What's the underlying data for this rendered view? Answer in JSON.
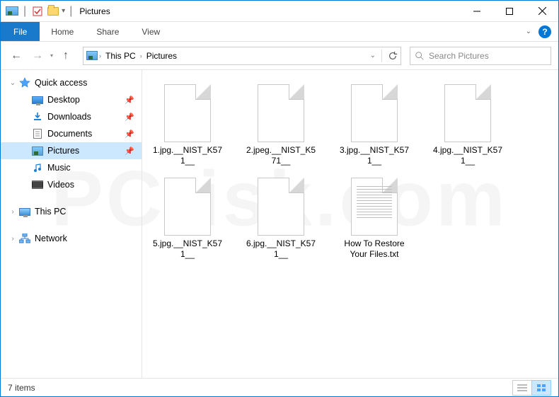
{
  "window": {
    "title": "Pictures"
  },
  "ribbon": {
    "file": "File",
    "tabs": [
      "Home",
      "Share",
      "View"
    ]
  },
  "breadcrumb": {
    "root": "This PC",
    "current": "Pictures"
  },
  "search": {
    "placeholder": "Search Pictures"
  },
  "sidebar": {
    "quick_access": "Quick access",
    "items": [
      {
        "label": "Desktop",
        "pin": true,
        "icon": "desktop"
      },
      {
        "label": "Downloads",
        "pin": true,
        "icon": "downloads"
      },
      {
        "label": "Documents",
        "pin": true,
        "icon": "documents"
      },
      {
        "label": "Pictures",
        "pin": true,
        "icon": "pictures",
        "selected": true
      },
      {
        "label": "Music",
        "pin": false,
        "icon": "music"
      },
      {
        "label": "Videos",
        "pin": false,
        "icon": "videos"
      }
    ],
    "this_pc": "This PC",
    "network": "Network"
  },
  "files": [
    {
      "name": "1.jpg.__NIST_K571__",
      "type": "blank"
    },
    {
      "name": "2.jpeg.__NIST_K571__",
      "type": "blank"
    },
    {
      "name": "3.jpg.__NIST_K571__",
      "type": "blank"
    },
    {
      "name": "4.jpg.__NIST_K571__",
      "type": "blank"
    },
    {
      "name": "5.jpg.__NIST_K571__",
      "type": "blank"
    },
    {
      "name": "6.jpg.__NIST_K571__",
      "type": "blank"
    },
    {
      "name": "How To Restore Your Files.txt",
      "type": "txt"
    }
  ],
  "status": {
    "count_label": "7 items"
  }
}
